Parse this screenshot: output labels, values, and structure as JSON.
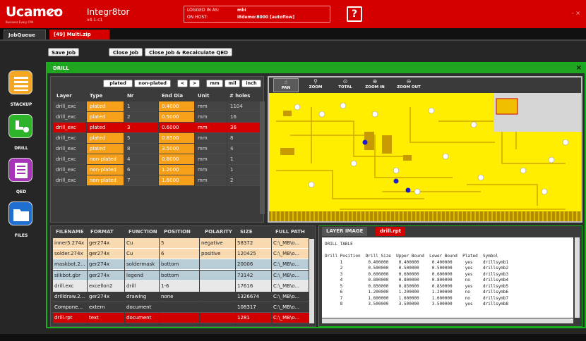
{
  "header": {
    "logo_text": "Ucamco",
    "logo_sub": "Business Every CPA",
    "app_name": "Integr8tor",
    "app_version": "v4.1-c1",
    "logged_in_label": "LOGGED IN AS:",
    "logged_in_value": "mbi",
    "host_label": "ON HOST:",
    "host_value": "i8demo:8000 [autoflow]",
    "help_label": "?",
    "window_controls": "- ×"
  },
  "tabs": [
    {
      "label": "JobQueue"
    },
    {
      "label": "[49] Multi.zip"
    }
  ],
  "job_actions": {
    "save": "Save Job",
    "close": "Close Job",
    "close_recalc": "Close Job & Recalculate QED"
  },
  "nav": [
    {
      "label": "STACKUP",
      "icon": "stackup-icon",
      "color": "#f5a623"
    },
    {
      "label": "DRILL",
      "icon": "drill-icon",
      "color": "#2db42a"
    },
    {
      "label": "QED",
      "icon": "qed-icon",
      "color": "#a633b8"
    },
    {
      "label": "FILES",
      "icon": "files-icon",
      "color": "#1f6fd1"
    }
  ],
  "drill": {
    "title": "DRILL",
    "close": "×",
    "filters": {
      "plated": "plated",
      "nonplated": "non-plated",
      "prev": "<",
      "next": ">",
      "mm": "mm",
      "mil": "mil",
      "inch": "inch"
    },
    "columns": [
      "Layer",
      "Type",
      "Nr",
      "End Dia",
      "Unit",
      "# holes"
    ],
    "rows": [
      {
        "layer": "drill_exc",
        "type": "plated",
        "nr": "1",
        "dia": "0.4000",
        "unit": "mm",
        "holes": "1104",
        "selected": false
      },
      {
        "layer": "drill_exc",
        "type": "plated",
        "nr": "2",
        "dia": "0.5000",
        "unit": "mm",
        "holes": "16",
        "selected": false
      },
      {
        "layer": "drill_exc",
        "type": "plated",
        "nr": "3",
        "dia": "0.6000",
        "unit": "mm",
        "holes": "36",
        "selected": true
      },
      {
        "layer": "drill_exc",
        "type": "plated",
        "nr": "5",
        "dia": "0.8500",
        "unit": "mm",
        "holes": "8",
        "selected": false
      },
      {
        "layer": "drill_exc",
        "type": "plated",
        "nr": "8",
        "dia": "3.5000",
        "unit": "mm",
        "holes": "4",
        "selected": false
      },
      {
        "layer": "drill_exc",
        "type": "non-plated",
        "nr": "4",
        "dia": "0.8000",
        "unit": "mm",
        "holes": "1",
        "selected": false
      },
      {
        "layer": "drill_exc",
        "type": "non-plated",
        "nr": "6",
        "dia": "1.2000",
        "unit": "mm",
        "holes": "1",
        "selected": false
      },
      {
        "layer": "drill_exc",
        "type": "non-plated",
        "nr": "7",
        "dia": "1.6000",
        "unit": "mm",
        "holes": "2",
        "selected": false
      }
    ]
  },
  "viewer": {
    "tools": [
      {
        "label": "PAN",
        "icon": "hand-icon",
        "glyph": "☝"
      },
      {
        "label": "ZOOM",
        "icon": "magnifier-icon",
        "glyph": "⚲"
      },
      {
        "label": "TOTAL",
        "icon": "zoom-total-icon",
        "glyph": "⊙"
      },
      {
        "label": "ZOOM IN",
        "icon": "zoom-in-icon",
        "glyph": "⊕"
      },
      {
        "label": "ZOOM OUT",
        "icon": "zoom-out-icon",
        "glyph": "⊖"
      }
    ]
  },
  "files": {
    "columns": [
      "FILENAME",
      "FORMAT",
      "FUNCTION",
      "POSITION",
      "POLARITY",
      "SIZE",
      "FULL PATH"
    ],
    "rows": [
      {
        "name": "inner5.274x",
        "format": "ger274x",
        "function": "Cu",
        "position": "5",
        "polarity": "negative",
        "size": "58372",
        "path": "C:\\_MB\\o...",
        "bg": "#f8d9b0"
      },
      {
        "name": "solder.274x",
        "format": "ger274x",
        "function": "Cu",
        "position": "6",
        "polarity": "positive",
        "size": "120425",
        "path": "C:\\_MB\\o...",
        "bg": "#f8d9b0"
      },
      {
        "name": "maskbot.2...",
        "format": "ger274x",
        "function": "soldermask",
        "position": "bottom",
        "polarity": "",
        "size": "20006",
        "path": "C:\\_MB\\o...",
        "bg": "#b9cdd6"
      },
      {
        "name": "silkbot.gbr",
        "format": "ger274x",
        "function": "legend",
        "position": "bottom",
        "polarity": "",
        "size": "73142",
        "path": "C:\\_MB\\o...",
        "bg": "#b9cdd6"
      },
      {
        "name": "drill.exc",
        "format": "excellon2",
        "function": "drill",
        "position": "1-6",
        "polarity": "",
        "size": "17616",
        "path": "C:\\_MB\\o...",
        "bg": "#e8e8e8"
      },
      {
        "name": "drilldraw.2...",
        "format": "ger274x",
        "function": "drawing",
        "position": "none",
        "polarity": "",
        "size": "1326674",
        "path": "C:\\_MB\\o...",
        "bg": "#3a3a3a"
      },
      {
        "name": "Compone...",
        "format": "extern",
        "function": "document",
        "position": "",
        "polarity": "",
        "size": "108317",
        "path": "C:\\_MB\\o...",
        "bg": "#3a3a3a"
      },
      {
        "name": "drill.rpt",
        "format": "text",
        "function": "document",
        "position": "",
        "polarity": "",
        "size": "1281",
        "path": "C:\\_MB\\o...",
        "bg": "#d00000"
      }
    ]
  },
  "report": {
    "tabs": [
      "LAYER IMAGE",
      "drill.rpt"
    ],
    "lines": [
      "DRILL TABLE",
      "",
      "Drill Position  Drill Size  Upper Bound  Lower Bound  Plated  Symbol",
      "      1          0.400000    0.400000     0.400000     yes    drillsymb1",
      "      2          0.500000    0.500000     0.500000     yes    drillsymb2",
      "      3          0.600000    0.600000     0.600000     yes    drillsymb3",
      "      4          0.800000    0.800000     0.800000     no     drillsymb4",
      "      5          0.850000    0.850000     0.850000     yes    drillsymb5",
      "      6          1.200000    1.200000     1.200000     no     drillsymb6",
      "      7          1.600000    1.600000     1.600000     no     drillsymb7",
      "      8          3.500000    3.500000     3.500000     yes    drillsymb8"
    ]
  }
}
